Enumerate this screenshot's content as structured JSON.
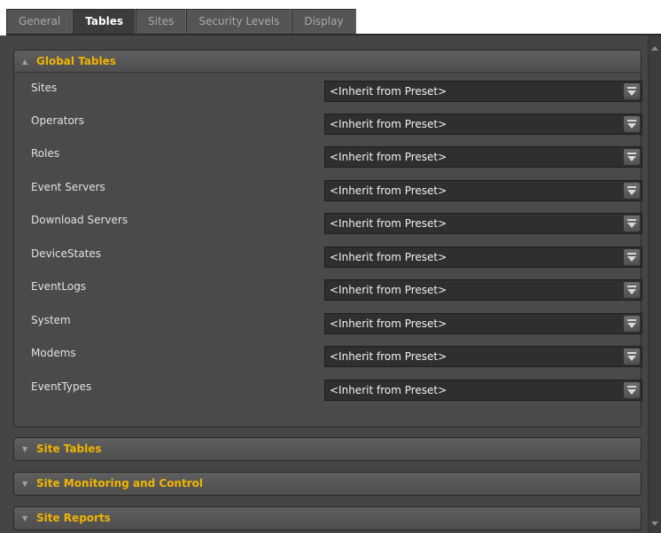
{
  "tabs": [
    {
      "label": "General"
    },
    {
      "label": "Tables",
      "active": true
    },
    {
      "label": "Sites"
    },
    {
      "label": "Security Levels"
    },
    {
      "label": "Display"
    }
  ],
  "global_tables": {
    "title": "Global Tables",
    "expanded": true,
    "rows": [
      {
        "label": "Sites",
        "value": "<Inherit from Preset>"
      },
      {
        "label": "Operators",
        "value": "<Inherit from Preset>"
      },
      {
        "label": "Roles",
        "value": "<Inherit from Preset>"
      },
      {
        "label": "Event Servers",
        "value": "<Inherit from Preset>"
      },
      {
        "label": "Download Servers",
        "value": "<Inherit from Preset>"
      },
      {
        "label": "DeviceStates",
        "value": "<Inherit from Preset>"
      },
      {
        "label": "EventLogs",
        "value": "<Inherit from Preset>"
      },
      {
        "label": "System",
        "value": "<Inherit from Preset>"
      },
      {
        "label": "Modems",
        "value": "<Inherit from Preset>"
      },
      {
        "label": "EventTypes",
        "value": "<Inherit from Preset>"
      }
    ]
  },
  "collapsed_sections": [
    {
      "title": "Site Tables"
    },
    {
      "title": "Site Monitoring and Control"
    },
    {
      "title": "Site Reports"
    }
  ],
  "colors": {
    "section_title": "#f0b400",
    "background": "#454545",
    "dropdown_bg": "#2f2f2f"
  },
  "icons": {
    "expanded_chevron": "chevron-up-icon",
    "collapsed_chevron": "chevron-down-icon",
    "dropdown": "dropdown-arrow-icon"
  }
}
